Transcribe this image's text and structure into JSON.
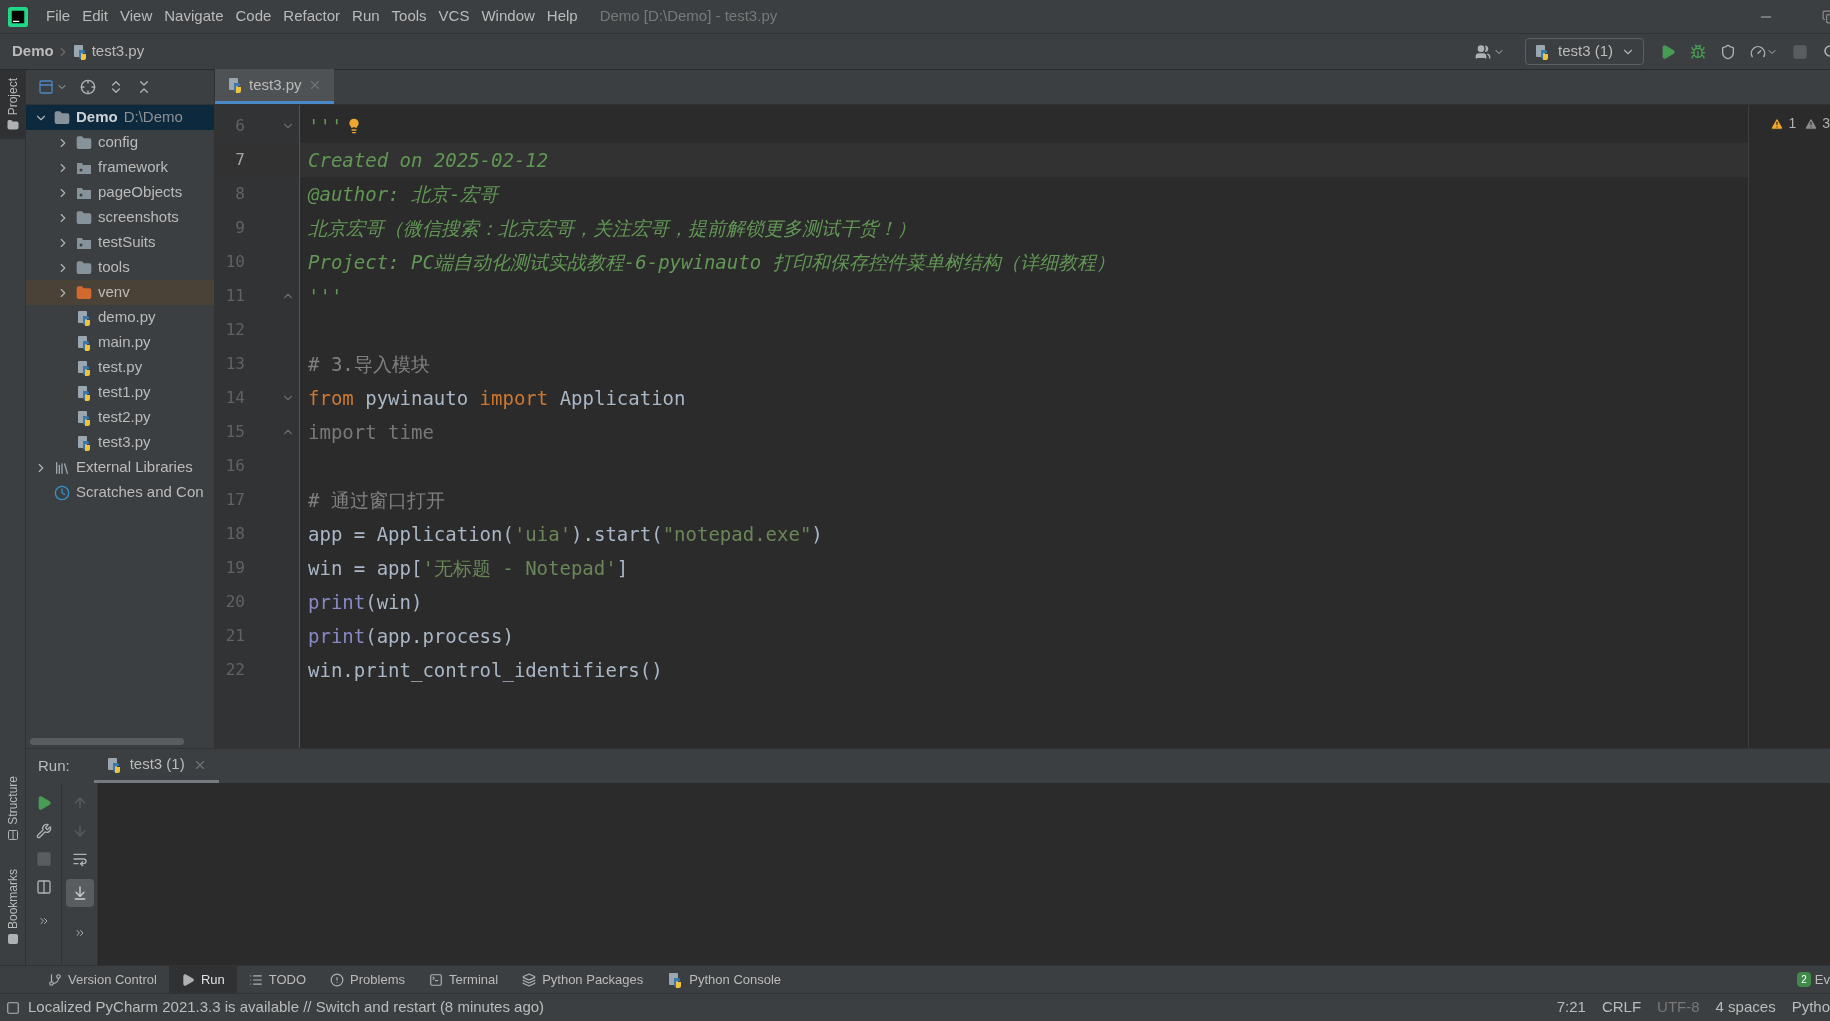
{
  "menu": [
    "File",
    "Edit",
    "View",
    "Navigate",
    "Code",
    "Refactor",
    "Run",
    "Tools",
    "VCS",
    "Window",
    "Help"
  ],
  "window_title": "Demo [D:\\Demo] - test3.py",
  "breadcrumb": [
    "Demo",
    "test3.py"
  ],
  "run_config": "test3 (1)",
  "left_strip_top": [
    {
      "label": "Project",
      "selected": true
    }
  ],
  "left_strip_bottom": [
    {
      "label": "Structure",
      "selected": false
    },
    {
      "label": "Bookmarks",
      "selected": false
    }
  ],
  "project_tree": [
    {
      "name": "Demo",
      "path": "D:\\Demo",
      "kind": "root",
      "expanded": true,
      "selected": true,
      "children": [
        {
          "name": "config",
          "kind": "folder",
          "expanded": false,
          "selected": false
        },
        {
          "name": "framework",
          "kind": "package",
          "expanded": false,
          "selected": false
        },
        {
          "name": "pageObjects",
          "kind": "package",
          "expanded": false,
          "selected": false
        },
        {
          "name": "screenshots",
          "kind": "folder",
          "expanded": false,
          "selected": false
        },
        {
          "name": "testSuits",
          "kind": "package",
          "expanded": false,
          "selected": false
        },
        {
          "name": "tools",
          "kind": "folder",
          "expanded": false,
          "selected": false
        },
        {
          "name": "venv",
          "kind": "excluded",
          "expanded": false,
          "selected": false
        },
        {
          "name": "demo.py",
          "kind": "file",
          "selected": false
        },
        {
          "name": "main.py",
          "kind": "file",
          "selected": false
        },
        {
          "name": "test.py",
          "kind": "file",
          "selected": false
        },
        {
          "name": "test1.py",
          "kind": "file",
          "selected": false
        },
        {
          "name": "test2.py",
          "kind": "file",
          "selected": false
        },
        {
          "name": "test3.py",
          "kind": "file",
          "selected": false
        }
      ]
    },
    {
      "name": "External Libraries",
      "kind": "libraries",
      "expanded": false,
      "selected": false
    },
    {
      "name": "Scratches and Con",
      "kind": "scratches",
      "selected": false
    }
  ],
  "editor_tabs": [
    {
      "label": "test3.py",
      "selected": true
    }
  ],
  "inspections": [
    {
      "kind": "warning",
      "count": "1"
    },
    {
      "kind": "weak",
      "count": "3"
    }
  ],
  "code_lines": [
    {
      "number": "6",
      "current": false,
      "fold_start": true,
      "tokens": [
        {
          "kind": "doc",
          "text": "'''"
        }
      ]
    },
    {
      "number": "7",
      "current": true,
      "tokens": [
        {
          "kind": "doc",
          "text": "Created on 2025-02-12"
        }
      ]
    },
    {
      "number": "8",
      "current": false,
      "tokens": [
        {
          "kind": "doc",
          "text": "@author: 北京-宏哥"
        }
      ]
    },
    {
      "number": "9",
      "current": false,
      "tokens": [
        {
          "kind": "doc",
          "text": "北京宏哥（微信搜索：北京宏哥，关注宏哥，提前解锁更多测试干货！）"
        }
      ]
    },
    {
      "number": "10",
      "current": false,
      "tokens": [
        {
          "kind": "doc",
          "text": "Project: PC端自动化测试实战教程-6-pywinauto 打印和保存控件菜单树结构（详细教程）"
        }
      ]
    },
    {
      "number": "11",
      "current": false,
      "fold_end": true,
      "tokens": [
        {
          "kind": "doc",
          "text": "'''"
        }
      ]
    },
    {
      "number": "12",
      "current": false
    },
    {
      "number": "13",
      "current": false,
      "tokens": [
        {
          "kind": "comment",
          "text": "# 3.导入模块"
        }
      ]
    },
    {
      "number": "14",
      "current": false,
      "fold_start": true,
      "tokens": [
        {
          "kind": "keyword",
          "text": "from "
        },
        {
          "kind": "plain",
          "text": "pywinauto "
        },
        {
          "kind": "keyword",
          "text": "import "
        },
        {
          "kind": "plain",
          "text": "Application"
        }
      ]
    },
    {
      "number": "15",
      "current": false,
      "fold_end": true,
      "tokens": [
        {
          "kind": "unused",
          "text": "import time"
        }
      ]
    },
    {
      "number": "16",
      "current": false
    },
    {
      "number": "17",
      "current": false,
      "tokens": [
        {
          "kind": "comment",
          "text": "# 通过窗口打开"
        }
      ]
    },
    {
      "number": "18",
      "current": false,
      "tokens": [
        {
          "kind": "plain",
          "text": "app = Application("
        },
        {
          "kind": "string",
          "text": "'uia'"
        },
        {
          "kind": "plain",
          "text": ").start("
        },
        {
          "kind": "string",
          "text": "\"notepad.exe\""
        },
        {
          "kind": "plain",
          "text": ")"
        }
      ]
    },
    {
      "number": "19",
      "current": false,
      "tokens": [
        {
          "kind": "plain",
          "text": "win = app["
        },
        {
          "kind": "string",
          "text": "'无标题 - Notepad'"
        },
        {
          "kind": "plain",
          "text": "]"
        }
      ]
    },
    {
      "number": "20",
      "current": false,
      "tokens": [
        {
          "kind": "builtin",
          "text": "print"
        },
        {
          "kind": "plain",
          "text": "(win)"
        }
      ]
    },
    {
      "number": "21",
      "current": false,
      "tokens": [
        {
          "kind": "builtin",
          "text": "print"
        },
        {
          "kind": "plain",
          "text": "(app.process)"
        }
      ]
    },
    {
      "number": "22",
      "current": false,
      "tokens": [
        {
          "kind": "plain",
          "text": "win.print_control_identifiers()"
        }
      ]
    }
  ],
  "run_panel": {
    "label": "Run:",
    "tabs": [
      {
        "label": "test3 (1)",
        "selected": true
      }
    ]
  },
  "bottom_tools": [
    {
      "label": "Version Control",
      "kind": "vcs",
      "selected": false
    },
    {
      "label": "Run",
      "kind": "run",
      "selected": true
    },
    {
      "label": "TODO",
      "kind": "todo",
      "selected": false
    },
    {
      "label": "Problems",
      "kind": "problems",
      "selected": false
    },
    {
      "label": "Terminal",
      "kind": "terminal",
      "selected": false
    },
    {
      "label": "Python Packages",
      "kind": "packages",
      "selected": false
    },
    {
      "label": "Python Console",
      "kind": "console",
      "selected": false
    }
  ],
  "event_log": {
    "count": "2",
    "label": "Ev"
  },
  "status_bar": {
    "message": "Localized PyCharm 2021.3.3 is available // Switch and restart (8 minutes ago)",
    "position": "7:21",
    "line_separator": "CRLF",
    "encoding": "UTF-8",
    "indent": "4 spaces",
    "interpreter": "Pytho"
  }
}
